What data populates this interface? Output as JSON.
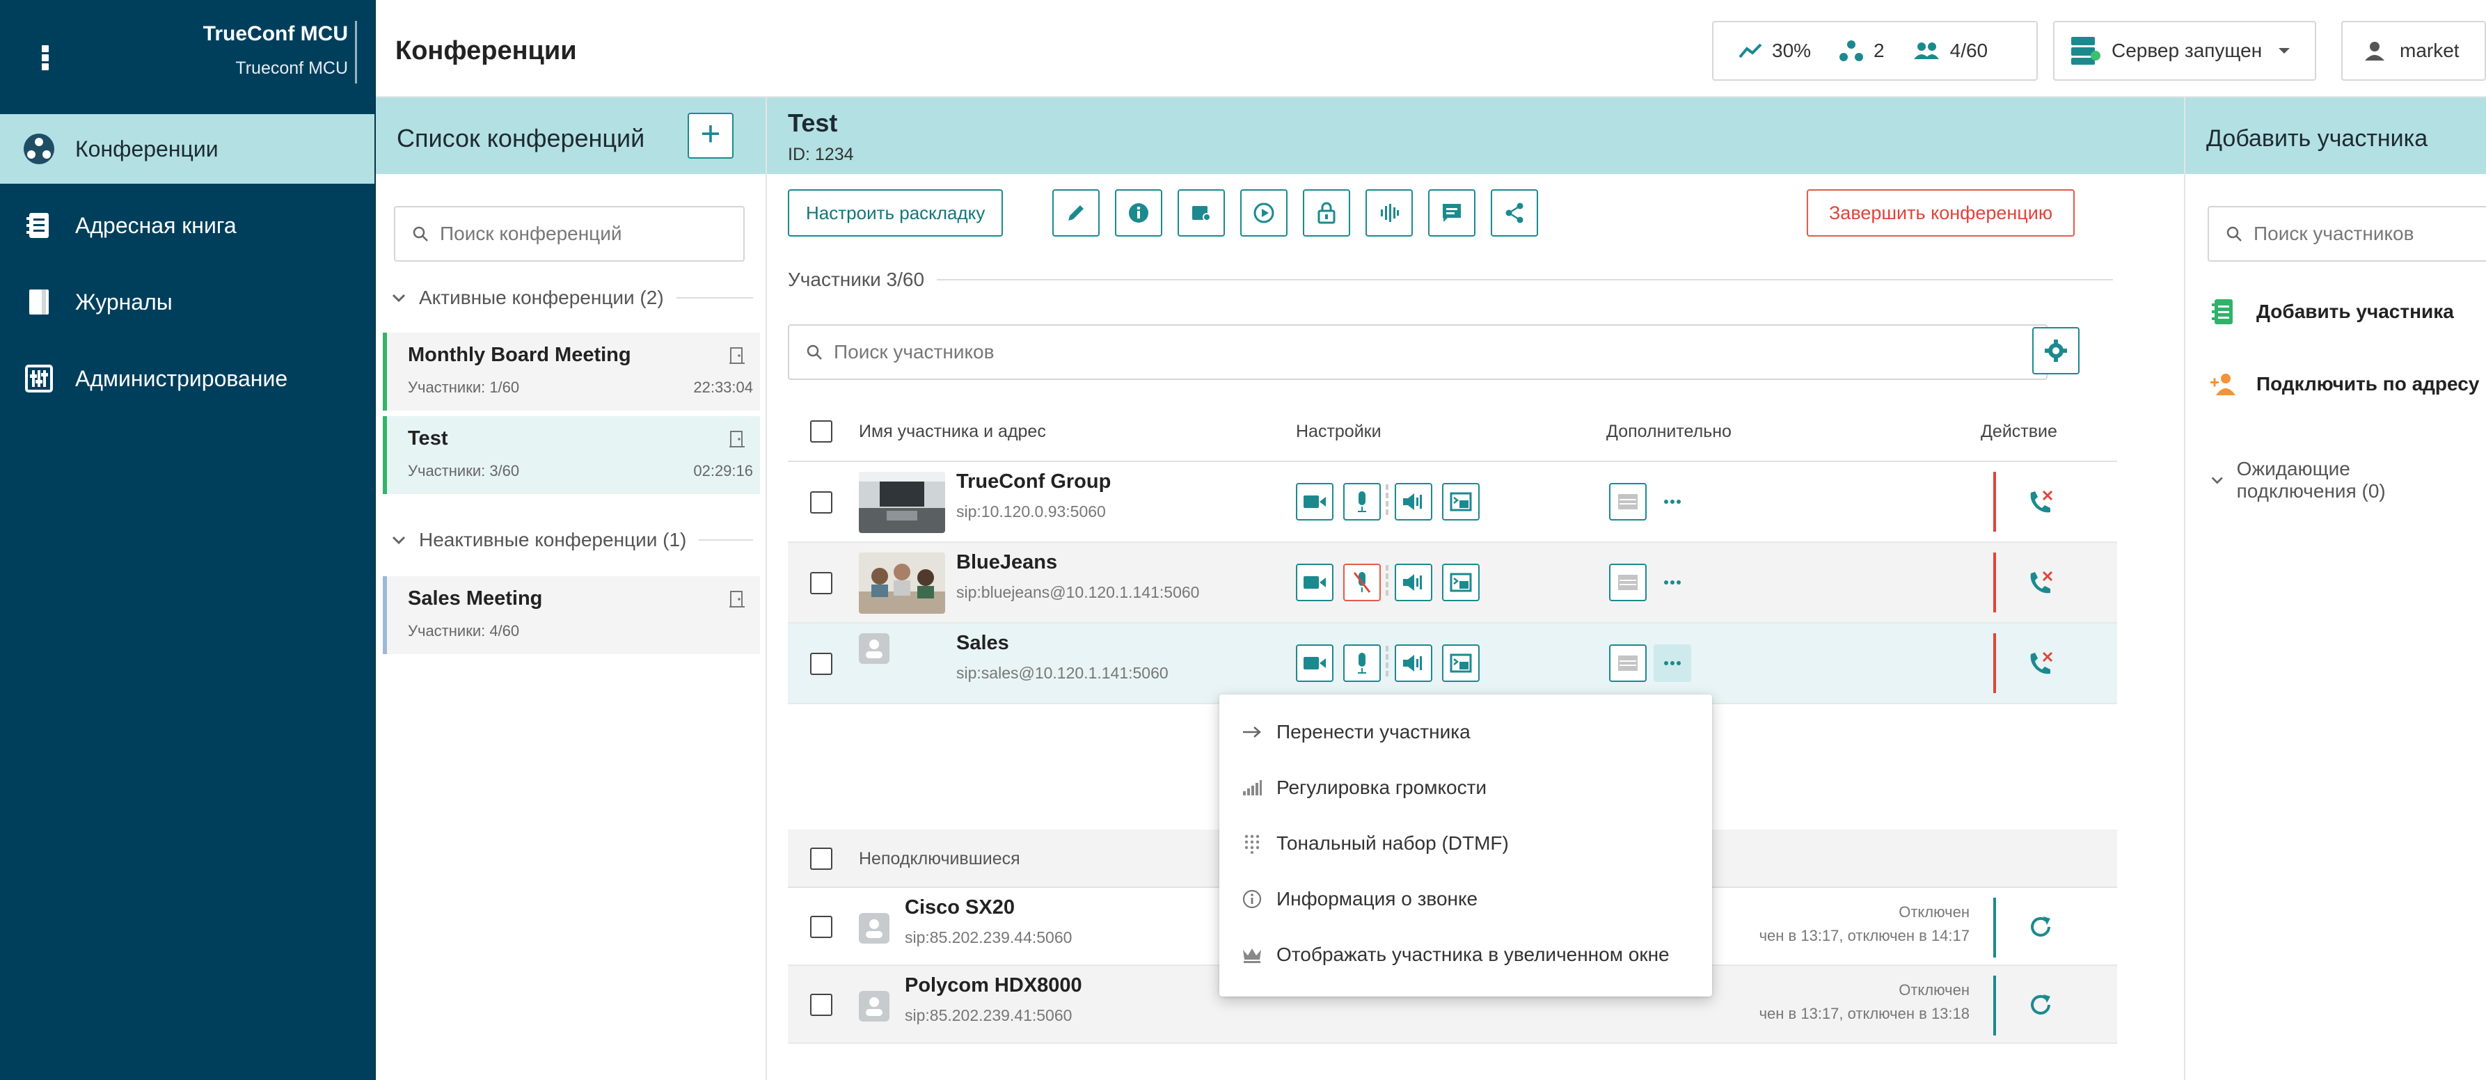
{
  "app": {
    "title": "TrueConf MCU",
    "subtitle": "Trueconf MCU"
  },
  "nav": {
    "items": [
      {
        "label": "Конференции",
        "icon": "conferences-icon",
        "active": true
      },
      {
        "label": "Адресная книга",
        "icon": "address-book-icon",
        "active": false
      },
      {
        "label": "Журналы",
        "icon": "logs-icon",
        "active": false
      },
      {
        "label": "Администрирование",
        "icon": "admin-icon",
        "active": false
      }
    ]
  },
  "header": {
    "title": "Конференции",
    "stats": {
      "load": "30%",
      "conferences": "2",
      "participants": "4/60"
    },
    "server_status": "Сервер запущен",
    "user": "market"
  },
  "conf_list": {
    "title": "Список конференций",
    "add_label": "+",
    "search_placeholder": "Поиск конференций",
    "active_group": "Активные конференции (2)",
    "inactive_group": "Неактивные конференции (1)",
    "active": [
      {
        "name": "Monthly Board Meeting",
        "participants": "Участники: 1/60",
        "time": "22:33:04"
      },
      {
        "name": "Test",
        "participants": "Участники: 3/60",
        "time": "02:29:16"
      }
    ],
    "inactive": [
      {
        "name": "Sales Meeting",
        "participants": "Участники: 4/60"
      }
    ]
  },
  "conference": {
    "name": "Test",
    "id": "ID: 1234",
    "layout_button": "Настроить раскладку",
    "end_button": "Завершить конференцию",
    "participants_label": "Участники 3/60",
    "search_placeholder": "Поиск участников",
    "columns": {
      "name": "Имя участника и адрес",
      "settings": "Настройки",
      "extra": "Дополнительно",
      "action": "Действие"
    },
    "participants": [
      {
        "name": "TrueConf Group",
        "address": "sip:10.120.0.93:5060",
        "mic_muted": false
      },
      {
        "name": "BlueJeans",
        "address": "sip:bluejeans@10.120.1.141:5060",
        "mic_muted": true
      },
      {
        "name": "Sales",
        "address": "sip:sales@10.120.1.141:5060",
        "mic_muted": false
      }
    ],
    "disconnected_label": "Неподключившиеся",
    "disconnected": [
      {
        "name": "Cisco SX20",
        "address": "sip:85.202.239.44:5060",
        "status": "Отключен",
        "detail": "чен в 13:17, отключен в 14:17"
      },
      {
        "name": "Polycom HDX8000",
        "address": "sip:85.202.239.41:5060",
        "status": "Отключен",
        "detail": "чен в 13:17, отключен в 13:18"
      }
    ]
  },
  "popup_menu": [
    {
      "label": "Перенести участника",
      "icon": "arrow-right-icon"
    },
    {
      "label": "Регулировка громкости",
      "icon": "volume-bars-icon"
    },
    {
      "label": "Тональный набор (DTMF)",
      "icon": "dialpad-icon"
    },
    {
      "label": "Информация о звонке",
      "icon": "info-icon"
    },
    {
      "label": "Отображать участника в увеличенном окне",
      "icon": "crown-icon"
    }
  ],
  "right_panel": {
    "title": "Добавить участника",
    "search_placeholder": "Поиск участников",
    "add_participant": "Добавить участника",
    "connect_by_address": "Подключить по адресу",
    "waiting": "Ожидающие подключения (0)"
  },
  "colors": {
    "nav_bg": "#003f5c",
    "accent": "#1b8a8f",
    "header_bg": "#b3e0e3",
    "danger": "#e0443a",
    "active_green": "#35b36b"
  }
}
